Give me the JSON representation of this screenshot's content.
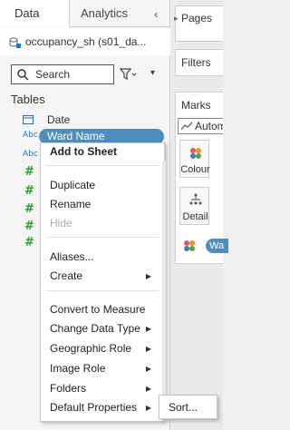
{
  "tabs": {
    "data": "Data",
    "analytics": "Analytics",
    "collapse_glyph": "‹"
  },
  "datasource": {
    "name": "occupancy_sh (s01_da...",
    "icon": "datasource-icon"
  },
  "search": {
    "placeholder": "Search",
    "icon": "search-icon",
    "filter_icon": "filter-icon",
    "menu_glyph": "▾"
  },
  "tables_header": "Tables",
  "fields": [
    {
      "type_icon": "calendar-icon",
      "label": "Date"
    },
    {
      "type_icon": "Abc",
      "label": "Ward Name"
    },
    {
      "type_icon": "Abc",
      "label": ""
    }
  ],
  "measure_glyph": "#",
  "right_pane": {
    "pages": "Pages",
    "filters": "Filters",
    "marks": "Marks",
    "marks_type": "Autom",
    "colour": "Colour",
    "detail": "Detail",
    "pill": "Wa"
  },
  "context_menu": {
    "add_to_sheet": "Add to Sheet",
    "duplicate": "Duplicate",
    "rename": "Rename",
    "hide": "Hide",
    "aliases": "Aliases...",
    "create": "Create",
    "convert_to_measure": "Convert to Measure",
    "change_data_type": "Change Data Type",
    "geographic_role": "Geographic Role",
    "image_role": "Image Role",
    "folders": "Folders",
    "default_properties": "Default Properties"
  },
  "submenu": {
    "sort": "Sort..."
  },
  "colors": {
    "accent": "#4e8fbf",
    "measure": "#2ca02c",
    "dimension": "#1f77b4"
  }
}
